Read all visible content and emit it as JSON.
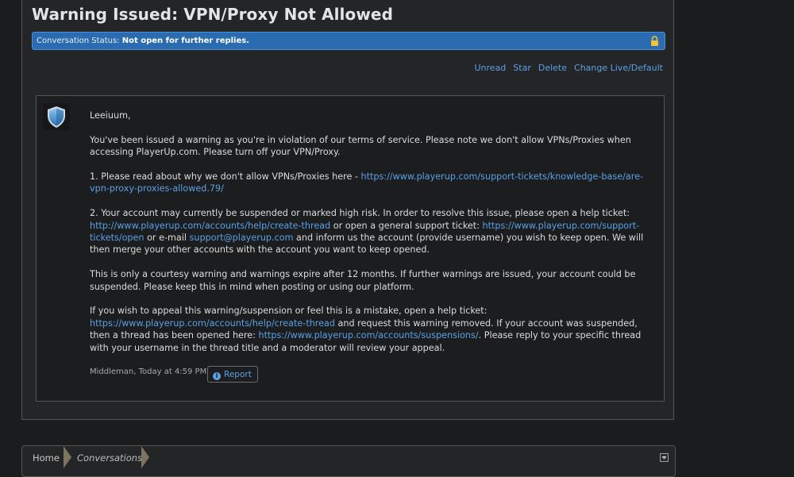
{
  "page": {
    "title": "Warning Issued: VPN/Proxy Not Allowed"
  },
  "status": {
    "label": "Conversation Status:",
    "value": "Not open for further replies.",
    "icon": "lock-icon",
    "color": "#2b6cb0"
  },
  "actions": [
    {
      "label": "Unread"
    },
    {
      "label": "Star"
    },
    {
      "label": "Delete"
    },
    {
      "label": "Change Live/Default"
    }
  ],
  "message": {
    "avatar_icon": "shield-icon",
    "greeting": "Leeiuum,",
    "p1": "You've been issued a warning as you're in violation of our terms of service. Please note we don't allow VPNs/Proxies when accessing PlayerUp.com. Please turn off your VPN/Proxy.",
    "p2_text": "1. Please read about why we don't allow VPNs/Proxies here - ",
    "p2_link": "https://www.playerup.com/support-tickets/knowledge-base/are-vpn-proxy-proxies-allowed.79/",
    "p3_text1": "2. Your account may currently be suspended or marked high risk. In order to resolve this issue, please open a help ticket: ",
    "p3_link1": "http://www.playerup.com/accounts/help/create-thread",
    "p3_text2": " or open a general support ticket: ",
    "p3_link2": "https://www.playerup.com/support-tickets/open",
    "p3_text3": " or e-mail ",
    "p3_link3": "support@playerup.com",
    "p3_text4": " and inform us the account (provide username) you wish to keep open. We will then merge your other accounts with the account you want to keep opened.",
    "p4": "This is only a courtesy warning and warnings expire after 12 months. If further warnings are issued, your account could be suspended. Please keep this in mind when posting or using our platform.",
    "p5_text1": "If you wish to appeal this warning/suspension or feel this is a mistake, open a help ticket: ",
    "p5_link1": "https://www.playerup.com/accounts/help/create-thread",
    "p5_text2": " and request this warning removed. If your account was suspended, then a thread has been opened here: ",
    "p5_link2": "https://www.playerup.com/accounts/suspensions/",
    "p5_text3": ". Please reply to your specific thread with your username in the thread title and a moderator will review your appeal.",
    "meta": "Middleman, Today at 4:59 PM",
    "report_label": "Report",
    "link_color": "#5ba0e5"
  },
  "breadcrumb": {
    "items": [
      {
        "label": "Home"
      },
      {
        "label": "Conversations"
      }
    ],
    "menu_icon": "chevron-down-icon"
  }
}
